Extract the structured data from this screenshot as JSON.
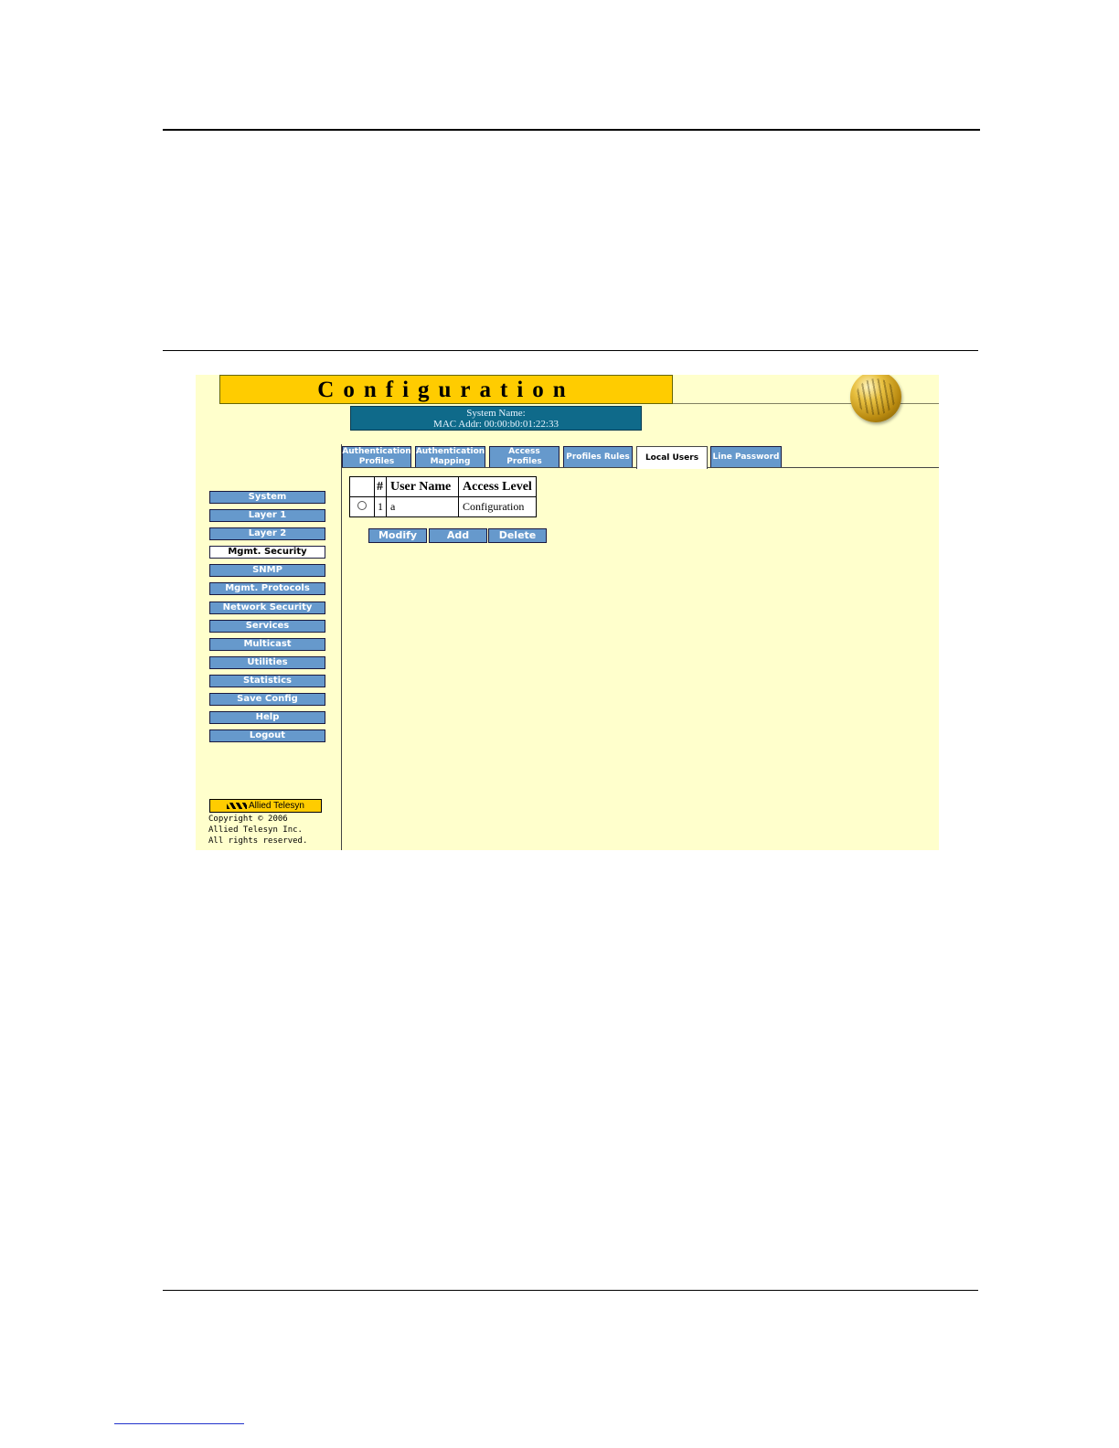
{
  "header": {
    "title": "Configuration",
    "system_name": "System Name:",
    "mac_addr": "MAC Addr:  00:00:b0:01:22:33"
  },
  "sidebar": {
    "items": [
      {
        "label": "System"
      },
      {
        "label": "Layer 1"
      },
      {
        "label": "Layer 2"
      },
      {
        "label": "Mgmt. Security",
        "active": true
      },
      {
        "label": "SNMP"
      },
      {
        "label": "Mgmt. Protocols"
      },
      {
        "label": "Network Security"
      },
      {
        "label": "Services"
      },
      {
        "label": "Multicast"
      },
      {
        "label": "Utilities"
      },
      {
        "label": "Statistics"
      },
      {
        "label": "Save Config"
      },
      {
        "label": "Help"
      },
      {
        "label": "Logout"
      }
    ]
  },
  "tabs": [
    {
      "label": "Authentication\nProfiles"
    },
    {
      "label": "Authentication\nMapping"
    },
    {
      "label": "Access Profiles"
    },
    {
      "label": "Profiles Rules"
    },
    {
      "label": "Local Users",
      "active": true
    },
    {
      "label": "Line Password"
    }
  ],
  "table": {
    "headers": [
      "",
      "#",
      "User Name",
      "Access Level"
    ],
    "rows": [
      {
        "num": "1",
        "user": "a",
        "level": "Configuration"
      }
    ]
  },
  "actions": {
    "modify": "Modify",
    "add": "Add",
    "delete": "Delete"
  },
  "footer": {
    "logo": "Allied Telesyn",
    "copyright": "Copyright © 2006",
    "company": "Allied Telesyn Inc.",
    "rights": "All rights reserved."
  },
  "colors": {
    "background": "#ffffcc",
    "title_bar": "#ffcc00",
    "button": "#6699cc",
    "info_bar": "#0f6a8a"
  }
}
